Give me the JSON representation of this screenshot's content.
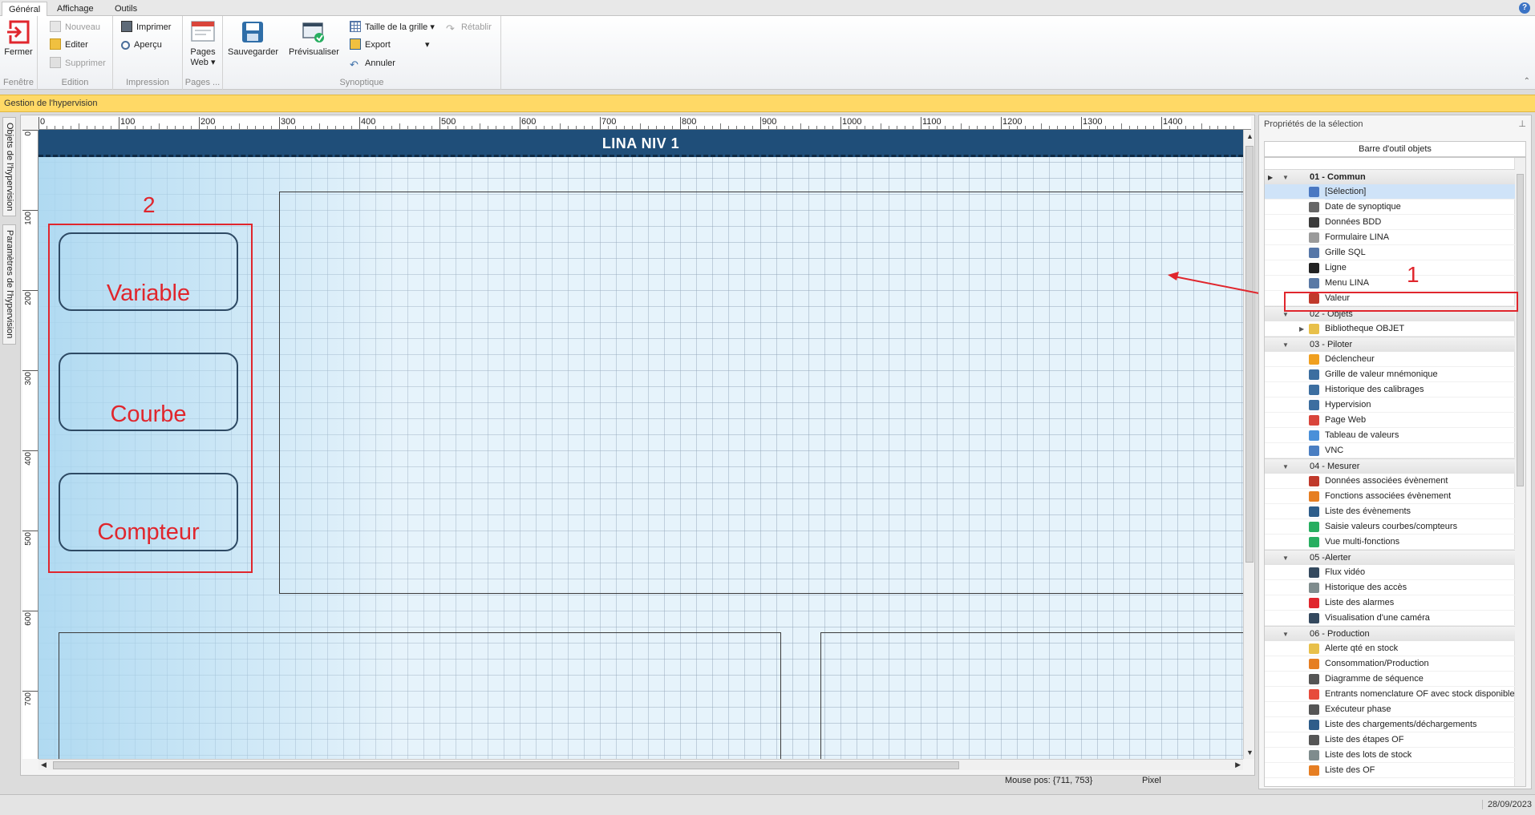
{
  "ribbon": {
    "tabs": [
      "Général",
      "Affichage",
      "Outils"
    ],
    "help_icon": "question-icon",
    "groups": {
      "fenetre": {
        "label": "Fenêtre",
        "fermer": "Fermer"
      },
      "edition": {
        "label": "Edition",
        "nouveau": "Nouveau",
        "editer": "Editer",
        "supprimer": "Supprimer"
      },
      "impression": {
        "label": "Impression",
        "imprimer": "Imprimer",
        "apercu": "Aperçu"
      },
      "pages": {
        "label": "Pages ...",
        "pages_web_line1": "Pages",
        "pages_web_line2": "Web ▾"
      },
      "synoptique": {
        "label": "Synoptique",
        "sauvegarder": "Sauvegarder",
        "previsualiser": "Prévisualiser",
        "taille_grille": "Taille de la grille",
        "export": "Export",
        "annuler": "Annuler",
        "retablir": "Rétablir"
      }
    }
  },
  "band": {
    "title": "Gestion de l'hypervision"
  },
  "left_tabs": {
    "objets": "Objets de l'hypervision",
    "parametres": "Paramètres de l'hypervision"
  },
  "ruler": {
    "top_labels": [
      "0",
      "100",
      "200",
      "300",
      "400",
      "500",
      "600",
      "700",
      "800",
      "900",
      "1000",
      "1100",
      "1200",
      "1300",
      "1400"
    ],
    "left_labels": [
      "0",
      "100",
      "200",
      "300",
      "400",
      "500",
      "600",
      "700"
    ]
  },
  "canvas": {
    "banner_title": "LINA NIV 1",
    "mouse_pos": "Mouse pos: {711, 753}",
    "unit": "Pixel"
  },
  "annotations": {
    "num1": "1",
    "num2": "2",
    "shapes": [
      "Variable",
      "Courbe",
      "Compteur"
    ]
  },
  "panel": {
    "title": "Propriétés de la sélection",
    "pin_icon": "pin-icon",
    "toolbar_header": "Barre d'outil objets",
    "categories": [
      {
        "label": "01 - Commun",
        "items": [
          {
            "label": "[Sélection]",
            "icon": "cursor-icon",
            "color": "#4a78c2"
          },
          {
            "label": "Date de synoptique",
            "icon": "calendar-icon",
            "color": "#666666"
          },
          {
            "label": "Données BDD",
            "icon": "database-icon",
            "color": "#3a3a3a"
          },
          {
            "label": "Formulaire LINA",
            "icon": "form-icon",
            "color": "#9a9a9a"
          },
          {
            "label": "Grille SQL",
            "icon": "grid-icon",
            "color": "#5677a8"
          },
          {
            "label": "Ligne",
            "icon": "line-icon",
            "color": "#222222"
          },
          {
            "label": "Menu LINA",
            "icon": "menu-icon",
            "color": "#5a79a5"
          },
          {
            "label": "Valeur",
            "icon": "value-icon",
            "color": "#c0392b"
          }
        ]
      },
      {
        "label": "02 - Objets",
        "items": [
          {
            "label": "Bibliotheque OBJET",
            "icon": "folder-icon",
            "color": "#e8c04a"
          }
        ]
      },
      {
        "label": "03 - Piloter",
        "items": [
          {
            "label": "Déclencheur",
            "icon": "lightning-icon",
            "color": "#f0a020"
          },
          {
            "label": "Grille de valeur mnémonique",
            "icon": "pin-icon",
            "color": "#3c6ea0"
          },
          {
            "label": "Historique des calibrages",
            "icon": "pen-icon",
            "color": "#3c6ea0"
          },
          {
            "label": "Hypervision",
            "icon": "monitor-icon",
            "color": "#3c6ea0"
          },
          {
            "label": "Page Web",
            "icon": "chrome-icon",
            "color": "#d9453b"
          },
          {
            "label": "Tableau de valeurs",
            "icon": "table-icon",
            "color": "#4a90d9"
          },
          {
            "label": "VNC",
            "icon": "vnc-icon",
            "color": "#4a7ec2"
          }
        ]
      },
      {
        "label": "04 - Mesurer",
        "items": [
          {
            "label": "Données associées évènement",
            "icon": "chart-icon",
            "color": "#c0392b"
          },
          {
            "label": "Fonctions associées évènement",
            "icon": "bar-chart-icon",
            "color": "#e67e22"
          },
          {
            "label": "Liste des évènements",
            "icon": "list-icon",
            "color": "#2e5d8a"
          },
          {
            "label": "Saisie valeurs courbes/compteurs",
            "icon": "plus-circle-icon",
            "color": "#27ae60"
          },
          {
            "label": "Vue multi-fonctions",
            "icon": "bars-icon",
            "color": "#27ae60"
          }
        ]
      },
      {
        "label": "05 -Alerter",
        "items": [
          {
            "label": "Flux vidéo",
            "icon": "camera-icon",
            "color": "#34495e"
          },
          {
            "label": "Historique des accès",
            "icon": "history-icon",
            "color": "#7f8c8d"
          },
          {
            "label": "Liste des alarmes",
            "icon": "warning-icon",
            "color": "#e0262d"
          },
          {
            "label": "Visualisation d'une caméra",
            "icon": "webcam-icon",
            "color": "#34495e"
          }
        ]
      },
      {
        "label": "06 - Production",
        "items": [
          {
            "label": "Alerte qté en stock",
            "icon": "box-icon",
            "color": "#e8c04a"
          },
          {
            "label": "Consommation/Production",
            "icon": "gears-icon",
            "color": "#e67e22"
          },
          {
            "label": "Diagramme de séquence",
            "icon": "sequence-icon",
            "color": "#555555"
          },
          {
            "label": "Entrants nomenclature OF avec stock disponible",
            "icon": "blocks-icon",
            "color": "#e74c3c"
          },
          {
            "label": "Exécuteur phase",
            "icon": "phase-icon",
            "color": "#555555"
          },
          {
            "label": "Liste des chargements/déchargements",
            "icon": "truck-icon",
            "color": "#2e5d8a"
          },
          {
            "label": "Liste des étapes OF",
            "icon": "steps-icon",
            "color": "#555555"
          },
          {
            "label": "Liste des lots de stock",
            "icon": "lots-icon",
            "color": "#7f8c8d"
          },
          {
            "label": "Liste des OF",
            "icon": "gears-icon",
            "color": "#e67e22"
          }
        ]
      }
    ]
  },
  "status": {
    "date": "28/09/2023"
  },
  "colors": {
    "accent_red": "#e0262d",
    "banner": "#1f4e79",
    "band": "#ffd966"
  }
}
